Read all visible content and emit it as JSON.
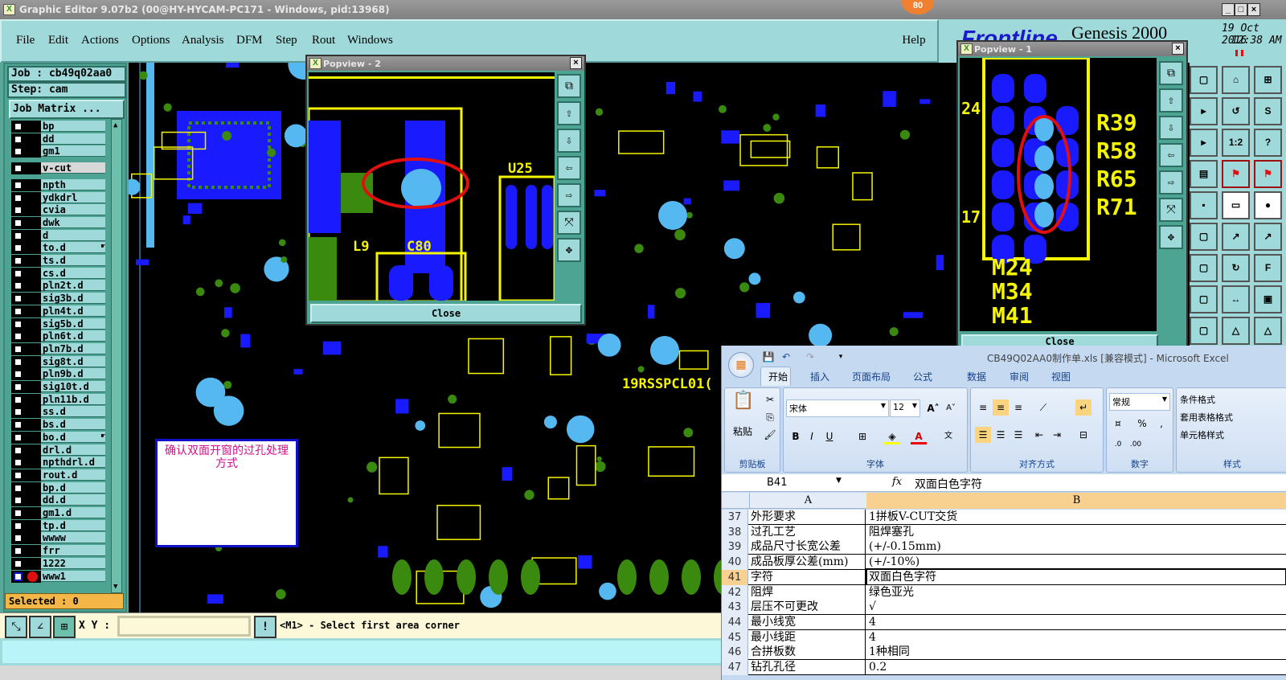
{
  "app": {
    "title": "Graphic Editor 9.07b2 (00@HY-HYCAM-PC171 - Windows, pid:13968)",
    "badge": "80",
    "window_controls": [
      "_",
      "□",
      "×"
    ]
  },
  "menu": {
    "items": [
      "File",
      "Edit",
      "Actions",
      "Options",
      "Analysis",
      "DFM",
      "Step",
      "Rout",
      "Windows"
    ],
    "help": "Help"
  },
  "logo": {
    "brand": "Frontline",
    "product": "Genesis 2000",
    "date": "19 Oct 2016",
    "time": "12:38 AM"
  },
  "job": {
    "job_label": "Job : cb49q02aa0",
    "step_label": "Step: cam",
    "matrix_button": "Job Matrix ..."
  },
  "layers": [
    {
      "name": "bp"
    },
    {
      "name": "dd"
    },
    {
      "name": "gm1"
    },
    {
      "name": "v-cut",
      "highlight": true
    },
    {
      "name": "npth"
    },
    {
      "name": "ydkdrl"
    },
    {
      "name": "cvia"
    },
    {
      "name": "dwk"
    },
    {
      "name": "d"
    },
    {
      "name": "to.d",
      "mark": true
    },
    {
      "name": "ts.d"
    },
    {
      "name": "cs.d"
    },
    {
      "name": "pln2t.d"
    },
    {
      "name": "sig3b.d"
    },
    {
      "name": "pln4t.d"
    },
    {
      "name": "sig5b.d"
    },
    {
      "name": "pln6t.d"
    },
    {
      "name": "pln7b.d"
    },
    {
      "name": "sig8t.d"
    },
    {
      "name": "pln9b.d"
    },
    {
      "name": "sig10t.d"
    },
    {
      "name": "pln11b.d"
    },
    {
      "name": "ss.d"
    },
    {
      "name": "bs.d"
    },
    {
      "name": "bo.d",
      "mark": true
    },
    {
      "name": "drl.d"
    },
    {
      "name": "npthdrl.d"
    },
    {
      "name": "rout.d"
    },
    {
      "name": "bp.d"
    },
    {
      "name": "dd.d"
    },
    {
      "name": "gm1.d"
    },
    {
      "name": "tp.d"
    },
    {
      "name": "wwww"
    },
    {
      "name": "frr"
    },
    {
      "name": "1222"
    },
    {
      "name": "www1",
      "active": true
    }
  ],
  "selected": "Selected : 0",
  "bottom": {
    "xy_label": "X Y :",
    "xy_value": "",
    "message": "<M1> - Select first area corner"
  },
  "canvas_labels": {
    "board_text": "19RSSPCL01("
  },
  "note": {
    "text": "确认双面开窗的过孔处理方式"
  },
  "popview2": {
    "title": "Popview - 2",
    "close": "Close",
    "labels": [
      "U25",
      "L9",
      "C80"
    ]
  },
  "popview1": {
    "title": "Popview - 1",
    "close": "Close",
    "labels": [
      "R39",
      "R58",
      "R65",
      "R71",
      "M24",
      "M34",
      "M41",
      "24",
      "17"
    ]
  },
  "colors": {
    "board_bg": "#000000",
    "pad_blue": "#1a1aff",
    "pad_light": "#55b8f0",
    "silk_yellow": "#f5f500",
    "mask_green": "#3a8a10",
    "highlight_circle": "#e01010"
  },
  "excel": {
    "title": "CB49Q02AA0制作单.xls  [兼容模式] - Microsoft Excel",
    "tabs": [
      "开始",
      "插入",
      "页面布局",
      "公式",
      "数据",
      "审阅",
      "视图"
    ],
    "clipboard": {
      "paste": "粘贴",
      "group": "剪贴板"
    },
    "font": {
      "name": "宋体",
      "size": "12",
      "group": "字体"
    },
    "align_group": "对齐方式",
    "number": {
      "format": "常规",
      "group": "数字"
    },
    "styles": {
      "items": [
        "条件格式",
        "套用表格格式",
        "单元格样式"
      ],
      "group": "样式"
    },
    "name_box": "B41",
    "formula": "双面白色字符",
    "columns": [
      "A",
      "B"
    ],
    "rows": [
      {
        "n": "37",
        "a": "外形要求",
        "b": "1拼板V-CUT交货"
      },
      {
        "n": "38",
        "a": "过孔工艺",
        "b": "阻焊塞孔"
      },
      {
        "n": "39",
        "a": "成品尺寸长宽公差",
        "b": "(+/-0.15mm)"
      },
      {
        "n": "40",
        "a": "成品板厚公差(mm)",
        "b": "(+/-10%)"
      },
      {
        "n": "41",
        "a": "字符",
        "b": "双面白色字符",
        "active": true
      },
      {
        "n": "42",
        "a": "阻焊",
        "b": "绿色亚光"
      },
      {
        "n": "43",
        "a": "层压不可更改",
        "b": "√"
      },
      {
        "n": "44",
        "a": "最小线宽",
        "b": "4"
      },
      {
        "n": "45",
        "a": "最小线距",
        "b": "4"
      },
      {
        "n": "46",
        "a": "合拼板数",
        "b": "1种相同"
      },
      {
        "n": "47",
        "a": "钻孔孔径",
        "b": "0.2"
      }
    ]
  }
}
